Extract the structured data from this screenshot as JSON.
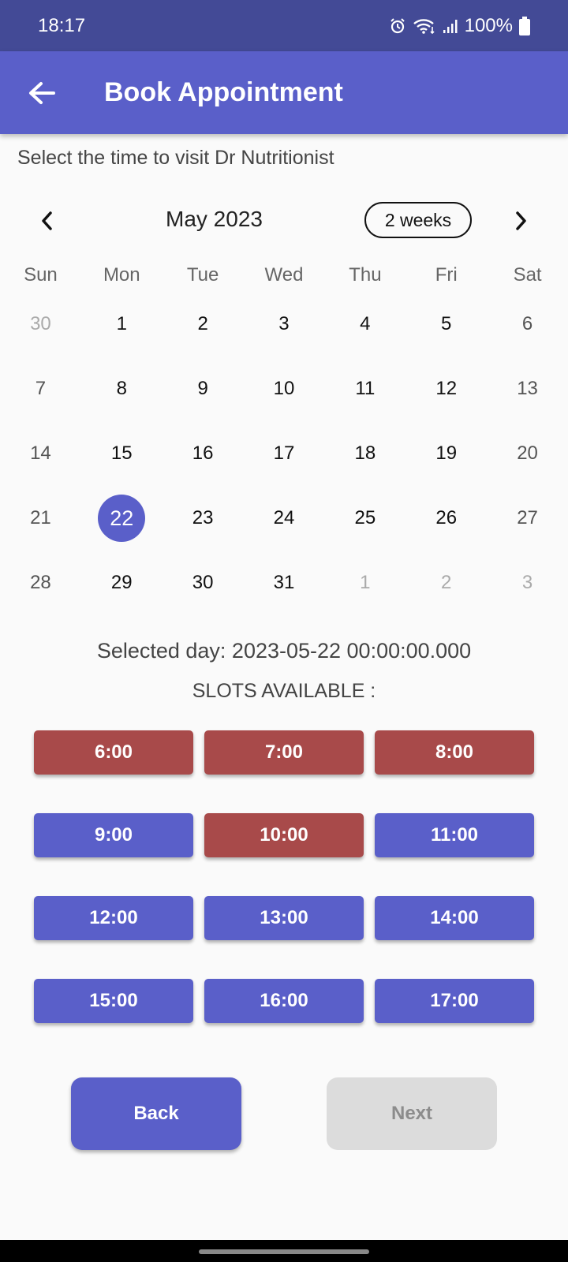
{
  "status": {
    "time": "18:17",
    "battery": "100%"
  },
  "app_bar": {
    "title": "Book Appointment"
  },
  "subtitle": "Select the time to visit Dr Nutritionist",
  "calendar": {
    "month_title": "May 2023",
    "format_button": "2 weeks",
    "weekdays": [
      "Sun",
      "Mon",
      "Tue",
      "Wed",
      "Thu",
      "Fri",
      "Sat"
    ],
    "days": [
      {
        "label": "30",
        "state": "outside"
      },
      {
        "label": "1",
        "state": "normal"
      },
      {
        "label": "2",
        "state": "normal"
      },
      {
        "label": "3",
        "state": "normal"
      },
      {
        "label": "4",
        "state": "normal"
      },
      {
        "label": "5",
        "state": "normal"
      },
      {
        "label": "6",
        "state": "weekend"
      },
      {
        "label": "7",
        "state": "weekend"
      },
      {
        "label": "8",
        "state": "normal"
      },
      {
        "label": "9",
        "state": "normal"
      },
      {
        "label": "10",
        "state": "normal"
      },
      {
        "label": "11",
        "state": "normal"
      },
      {
        "label": "12",
        "state": "normal"
      },
      {
        "label": "13",
        "state": "weekend"
      },
      {
        "label": "14",
        "state": "weekend"
      },
      {
        "label": "15",
        "state": "normal"
      },
      {
        "label": "16",
        "state": "normal"
      },
      {
        "label": "17",
        "state": "normal"
      },
      {
        "label": "18",
        "state": "normal"
      },
      {
        "label": "19",
        "state": "normal"
      },
      {
        "label": "20",
        "state": "weekend"
      },
      {
        "label": "21",
        "state": "weekend"
      },
      {
        "label": "22",
        "state": "selected"
      },
      {
        "label": "23",
        "state": "normal"
      },
      {
        "label": "24",
        "state": "normal"
      },
      {
        "label": "25",
        "state": "normal"
      },
      {
        "label": "26",
        "state": "normal"
      },
      {
        "label": "27",
        "state": "weekend"
      },
      {
        "label": "28",
        "state": "weekend"
      },
      {
        "label": "29",
        "state": "normal"
      },
      {
        "label": "30",
        "state": "normal"
      },
      {
        "label": "31",
        "state": "normal"
      },
      {
        "label": "1",
        "state": "outside"
      },
      {
        "label": "2",
        "state": "outside"
      },
      {
        "label": "3",
        "state": "outside"
      }
    ]
  },
  "selected_day_text": "Selected day: 2023-05-22 00:00:00.000",
  "slots_title": "SLOTS AVAILABLE :",
  "slots": [
    {
      "label": "6:00",
      "status": "booked"
    },
    {
      "label": "7:00",
      "status": "booked"
    },
    {
      "label": "8:00",
      "status": "booked"
    },
    {
      "label": "9:00",
      "status": "available"
    },
    {
      "label": "10:00",
      "status": "booked"
    },
    {
      "label": "11:00",
      "status": "available"
    },
    {
      "label": "12:00",
      "status": "available"
    },
    {
      "label": "13:00",
      "status": "available"
    },
    {
      "label": "14:00",
      "status": "available"
    },
    {
      "label": "15:00",
      "status": "available"
    },
    {
      "label": "16:00",
      "status": "available"
    },
    {
      "label": "17:00",
      "status": "available"
    }
  ],
  "buttons": {
    "back": "Back",
    "next": "Next"
  },
  "colors": {
    "primary": "#5a5fc9",
    "status_bar": "#434a96",
    "booked": "#a84a4a",
    "disabled": "#dcdcdc"
  },
  "icons": [
    "alarm-icon",
    "wifi-icon",
    "signal-icon",
    "battery-icon",
    "back-arrow-icon",
    "chevron-left-icon",
    "chevron-right-icon"
  ]
}
